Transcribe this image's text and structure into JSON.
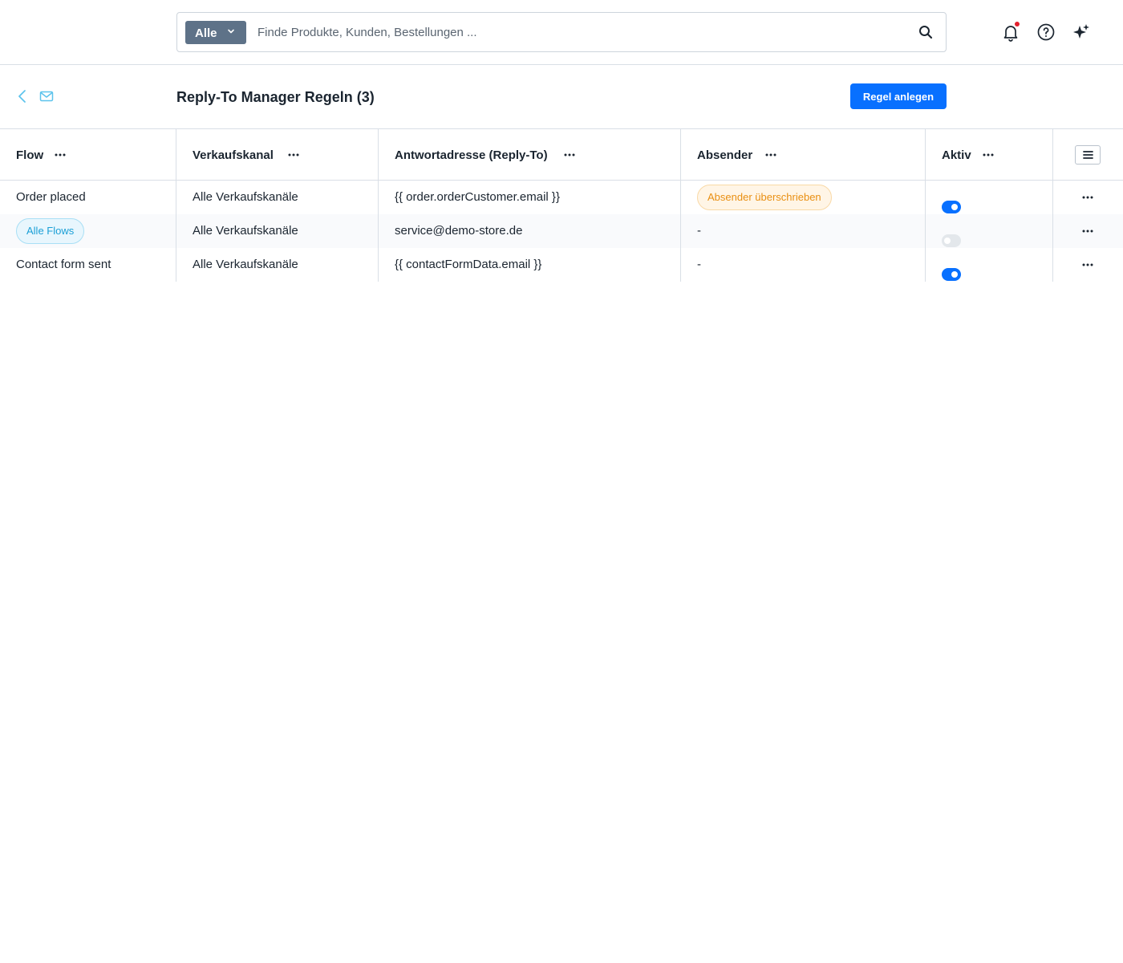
{
  "search": {
    "type_label": "Alle",
    "placeholder": "Finde Produkte, Kunden, Bestellungen ..."
  },
  "page": {
    "title": "Reply-To Manager Regeln (3)",
    "create_button": "Regel anlegen"
  },
  "table": {
    "columns": [
      {
        "label": "Flow"
      },
      {
        "label": "Verkaufskanal"
      },
      {
        "label": "Antwortadresse (Reply-To)"
      },
      {
        "label": "Absender"
      },
      {
        "label": "Aktiv"
      }
    ],
    "rows": [
      {
        "flow": "Order placed",
        "sales_channel": "Alle Verkaufskanäle",
        "reply_to": "{{ order.orderCustomer.email }}",
        "sender": "Absender überschrieben",
        "active": true
      },
      {
        "flow": "Alle Flows",
        "sales_channel": "Alle Verkaufskanäle",
        "reply_to": "service@demo-store.de",
        "sender": "-",
        "active": false
      },
      {
        "flow": "Contact form sent",
        "sales_channel": "Alle Verkaufskanäle",
        "reply_to": "{{ contactFormData.email }}",
        "sender": "-",
        "active": true
      }
    ]
  },
  "icons": {
    "search": "search-icon",
    "notifications": "bell-icon",
    "help": "help-icon",
    "ai": "sparkle-icon",
    "back": "chevron-left-icon",
    "mail": "mail-icon",
    "more": "more-horizontal-icon",
    "columns": "list-icon"
  },
  "colors": {
    "primary": "#0870ff",
    "warning_pill": "#e98f12",
    "info_pill": "#1a9fd6",
    "notification_dot": "#e3202d"
  }
}
